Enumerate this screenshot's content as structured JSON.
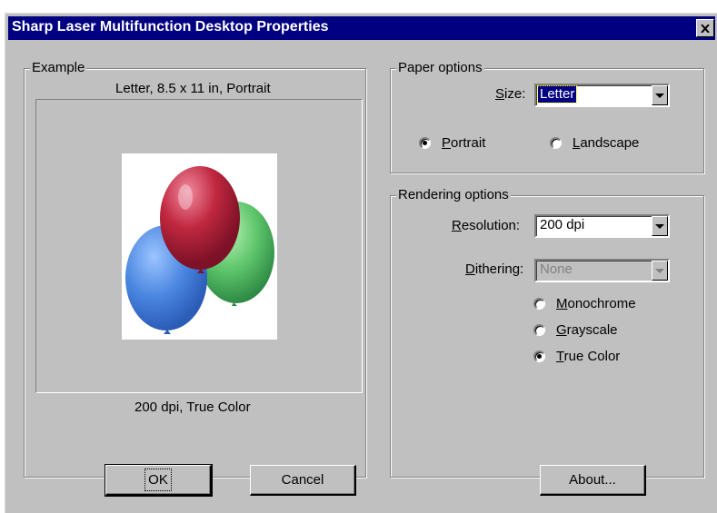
{
  "window": {
    "title": "Sharp Laser Multifunction Desktop Properties",
    "close_icon": "close-icon"
  },
  "example": {
    "legend": "Example",
    "paper_caption": "Letter, 8.5 x 11 in, Portrait",
    "render_caption": "200 dpi, True Color",
    "image_icon": "balloons-image"
  },
  "paper_options": {
    "legend": "Paper options",
    "size_label_ul": "S",
    "size_label_rest": "ize:",
    "size_value": "Letter",
    "portrait_ul": "P",
    "portrait_rest": "ortrait",
    "landscape_ul": "L",
    "landscape_rest": "andscape",
    "orientation_selected": "Portrait"
  },
  "rendering_options": {
    "legend": "Rendering options",
    "resolution_label_ul": "R",
    "resolution_label_rest": "esolution:",
    "resolution_value": "200 dpi",
    "dithering_label_ul": "D",
    "dithering_label_rest": "ithering:",
    "dithering_value": "None",
    "monochrome_ul": "M",
    "monochrome_rest": "onochrome",
    "grayscale_ul": "G",
    "grayscale_rest": "rayscale",
    "truecolor_ul": "T",
    "truecolor_rest": "rue Color",
    "color_mode_selected": "True Color"
  },
  "buttons": {
    "ok": "OK",
    "cancel": "Cancel",
    "about": "About..."
  },
  "colors": {
    "titlebar": "#000080",
    "face": "#c0c0c0",
    "balloon_red": "#c0283f",
    "balloon_blue": "#4a86e0",
    "balloon_green": "#5cc46a"
  }
}
